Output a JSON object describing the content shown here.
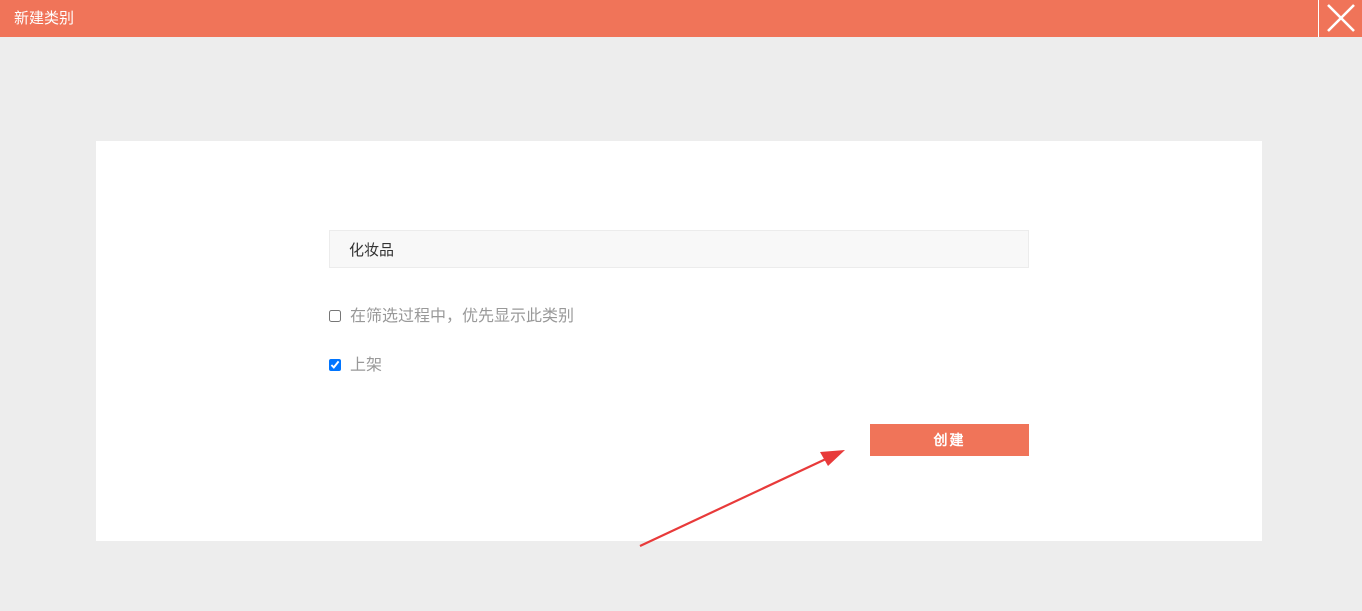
{
  "window": {
    "title": "新建类别"
  },
  "form": {
    "name_value": "化妆品",
    "checkboxes": [
      {
        "label": "在筛选过程中，优先显示此类别",
        "checked": false
      },
      {
        "label": "上架",
        "checked": true
      }
    ],
    "submit_label": "创建"
  },
  "colors": {
    "accent": "#f07459",
    "background": "#ededed",
    "panel": "#ffffff",
    "annotation_arrow": "#e83a3a"
  },
  "icons": {
    "close": "close-icon",
    "annotation": "arrow-annotation-icon"
  }
}
